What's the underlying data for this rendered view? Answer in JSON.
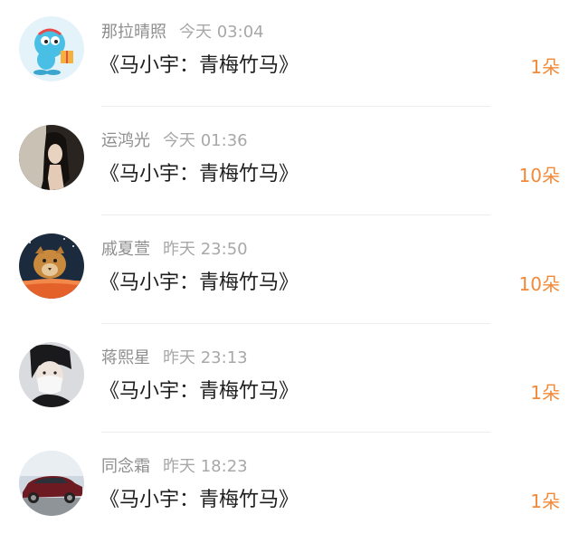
{
  "accent_color": "#f08a3a",
  "items": [
    {
      "name": "那拉晴照",
      "time": "今天 03:04",
      "title": "《马小宇：青梅竹马》",
      "count": "1朵",
      "avatar": "cartoon-character-avatar"
    },
    {
      "name": "运鸿光",
      "time": "今天 01:36",
      "title": "《马小宇：青梅竹马》",
      "count": "10朵",
      "avatar": "woman-portrait-avatar"
    },
    {
      "name": "戚夏萱",
      "time": "昨天 23:50",
      "title": "《马小宇：青梅竹马》",
      "count": "10朵",
      "avatar": "lion-avatar"
    },
    {
      "name": "蒋熙星",
      "time": "昨天 23:13",
      "title": "《马小宇：青梅竹马》",
      "count": "1朵",
      "avatar": "masked-person-avatar"
    },
    {
      "name": "同念霜",
      "time": "昨天 18:23",
      "title": "《马小宇：青梅竹马》",
      "count": "1朵",
      "avatar": "car-avatar"
    }
  ]
}
